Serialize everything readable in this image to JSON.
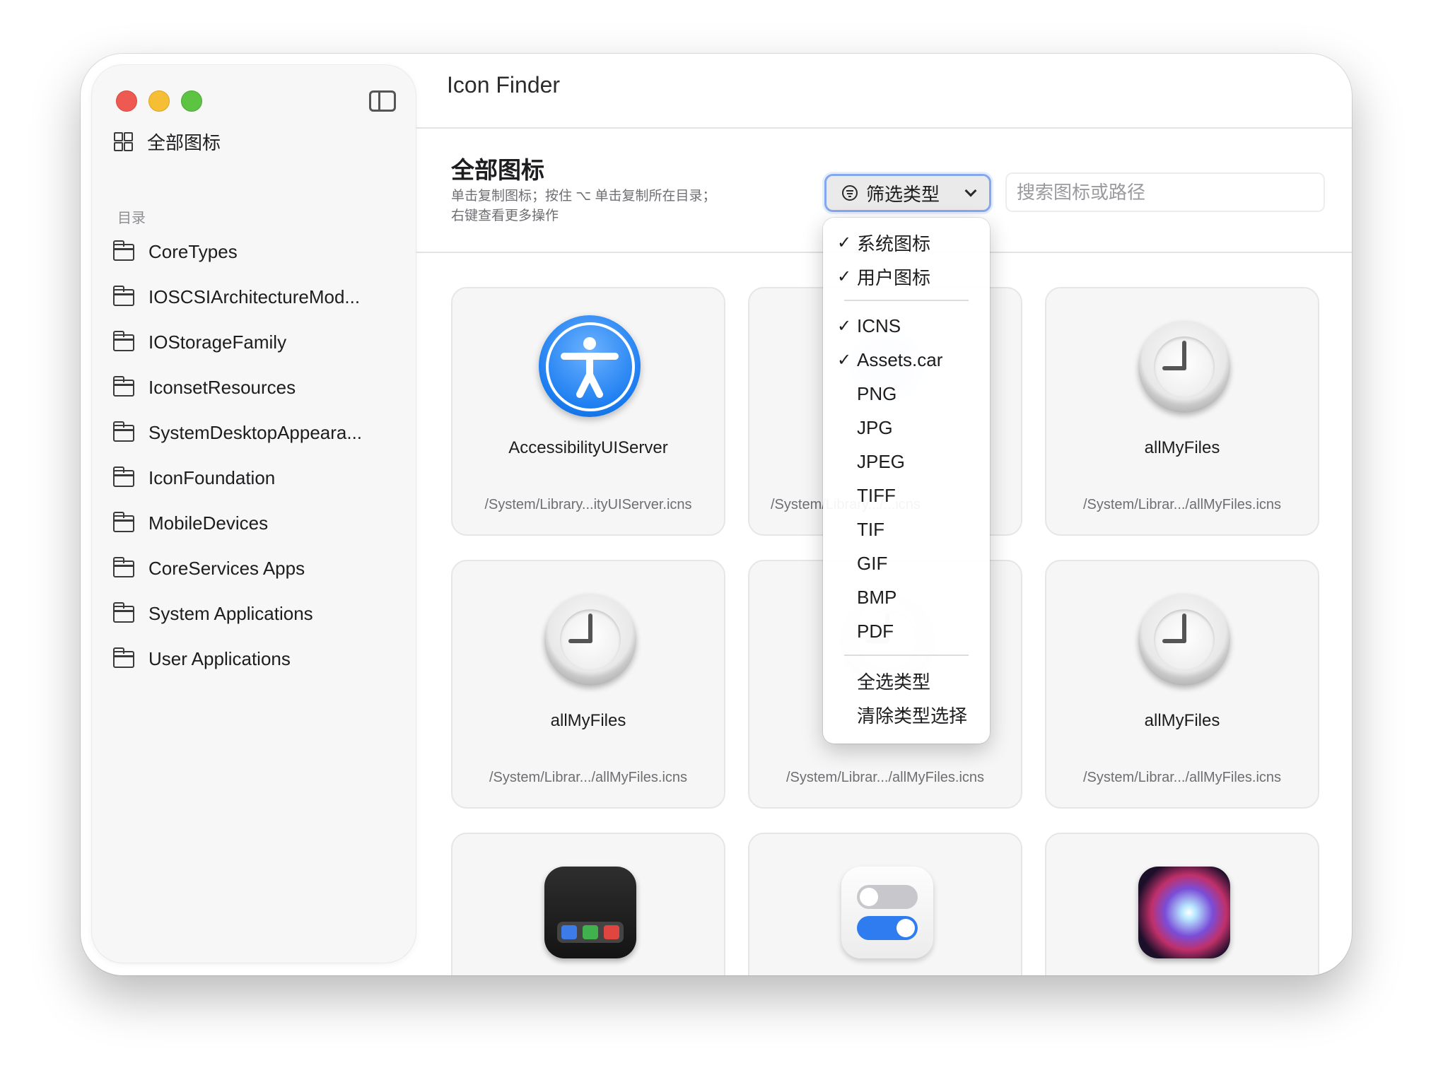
{
  "window": {
    "title": "Icon Finder"
  },
  "sidebar": {
    "all_icons_label": "全部图标",
    "section_label": "目录",
    "items": [
      {
        "label": "CoreTypes"
      },
      {
        "label": "IOSCSIArchitectureMod..."
      },
      {
        "label": "IOStorageFamily"
      },
      {
        "label": "IconsetResources"
      },
      {
        "label": "SystemDesktopAppeara..."
      },
      {
        "label": "IconFoundation"
      },
      {
        "label": "MobileDevices"
      },
      {
        "label": "CoreServices Apps"
      },
      {
        "label": "System Applications"
      },
      {
        "label": "User Applications"
      }
    ]
  },
  "main": {
    "title": "全部图标",
    "help_line1": "单击复制图标；按住 ⌥ 单击复制所在目录；",
    "help_line2": "右键查看更多操作",
    "filter_button_label": "筛选类型",
    "search_placeholder": "搜索图标或路径",
    "search_value": ""
  },
  "cards": [
    {
      "name": "AccessibilityUIServer",
      "path": "/System/Library...ityUIServer.icns",
      "icon": "accessibility-icon"
    },
    {
      "name": "",
      "path": "/System/Library.../...icns",
      "icon": "app-icon"
    },
    {
      "name": "allMyFiles",
      "path": "/System/Librar.../allMyFiles.icns",
      "icon": "clock-icon"
    },
    {
      "name": "allMyFiles",
      "path": "/System/Librar.../allMyFiles.icns",
      "icon": "clock-icon"
    },
    {
      "name": "",
      "path": "/System/Librar.../allMyFiles.icns",
      "icon": "clock-icon"
    },
    {
      "name": "allMyFiles",
      "path": "/System/Librar.../allMyFiles.icns",
      "icon": "clock-icon"
    },
    {
      "name": "",
      "path": "",
      "icon": "dock-icon"
    },
    {
      "name": "",
      "path": "",
      "icon": "toggles-icon"
    },
    {
      "name": "",
      "path": "",
      "icon": "siri-icon"
    }
  ],
  "filter_menu": {
    "items": [
      {
        "label": "系统图标",
        "checked": true
      },
      {
        "label": "用户图标",
        "checked": true
      },
      {
        "label": "ICNS",
        "checked": true
      },
      {
        "label": "Assets.car",
        "checked": true
      },
      {
        "label": "PNG",
        "checked": false
      },
      {
        "label": "JPG",
        "checked": false
      },
      {
        "label": "JPEG",
        "checked": false
      },
      {
        "label": "TIFF",
        "checked": false
      },
      {
        "label": "TIF",
        "checked": false
      },
      {
        "label": "GIF",
        "checked": false
      },
      {
        "label": "BMP",
        "checked": false
      },
      {
        "label": "PDF",
        "checked": false
      }
    ],
    "select_all_label": "全选类型",
    "clear_label": "清除类型选择",
    "check_glyph": "✓"
  },
  "colors": {
    "accent": "#1a7cf0",
    "focus_ring": "#85a7ee"
  }
}
